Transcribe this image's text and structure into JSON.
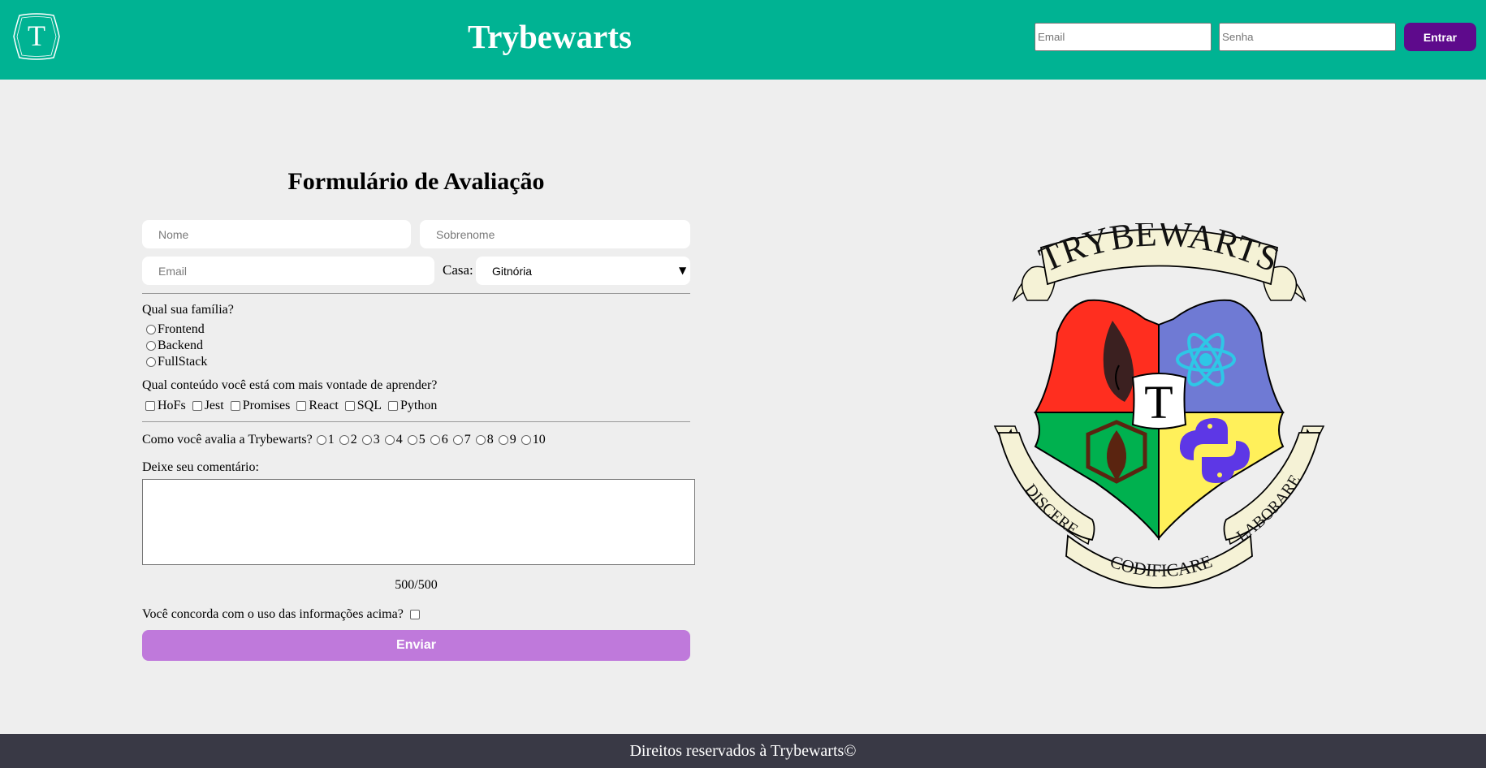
{
  "header": {
    "logo_letter": "T",
    "title": "Trybewarts",
    "login": {
      "email_placeholder": "Email",
      "password_placeholder": "Senha",
      "button_label": "Entrar"
    },
    "colors": {
      "bar": "#00b393",
      "button": "#5e0a8c"
    }
  },
  "form": {
    "title": "Formulário de Avaliação",
    "name_placeholder": "Nome",
    "lastname_placeholder": "Sobrenome",
    "email_placeholder": "Email",
    "house_label": "Casa:",
    "house_selected": "Gitnória",
    "family_question": "Qual sua família?",
    "families": [
      "Frontend",
      "Backend",
      "FullStack"
    ],
    "content_question": "Qual conteúdo você está com mais vontade de aprender?",
    "contents": [
      "HoFs",
      "Jest",
      "Promises",
      "React",
      "SQL",
      "Python"
    ],
    "rating_question": "Como você avalia a Trybewarts?",
    "ratings": [
      "1",
      "2",
      "3",
      "4",
      "5",
      "6",
      "7",
      "8",
      "9",
      "10"
    ],
    "comment_label": "Deixe seu comentário:",
    "counter": "500/500",
    "agreement_label": "Você concorda com o uso das informações acima?",
    "submit_label": "Enviar",
    "colors": {
      "submit": "#bf79db"
    }
  },
  "crest": {
    "banner_text": "TRYBEWARTS",
    "center_letter": "T",
    "motto_left": "DISCERE",
    "motto_bottom": "CODIFICARE",
    "motto_right": "LABORARE",
    "quadrant_colors": [
      "#ff2e1f",
      "#6f7ad4",
      "#00b14f",
      "#fff05a"
    ],
    "quadrant_icons": [
      "flame-icon",
      "react-atom-icon",
      "mongodb-leaf-icon",
      "python-icon"
    ]
  },
  "footer": {
    "text": "Direitos reservados à Trybewarts©",
    "color": "#393945"
  }
}
